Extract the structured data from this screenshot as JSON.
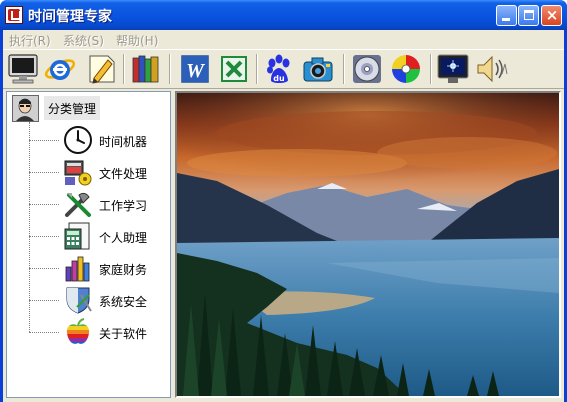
{
  "window": {
    "title": "时间管理专家",
    "accent": "#0a55e0"
  },
  "titlebar_buttons": {
    "minimize": "minimize-icon",
    "maximize": "maximize-icon",
    "close_glyph": "×"
  },
  "menu": {
    "items": [
      {
        "label": "执行(R)"
      },
      {
        "label": "系统(S)"
      },
      {
        "label": "帮助(H)"
      }
    ]
  },
  "toolbar": {
    "buttons": [
      {
        "icon": "monitor-icon"
      },
      {
        "icon": "internet-explorer-icon"
      },
      {
        "icon": "edit-document-icon"
      },
      {
        "icon": "books-icon"
      },
      {
        "icon": "word-icon"
      },
      {
        "icon": "excel-icon"
      },
      {
        "icon": "baidu-paw-icon"
      },
      {
        "icon": "camera-icon"
      },
      {
        "icon": "media-disc-icon"
      },
      {
        "icon": "color-cd-icon"
      },
      {
        "icon": "screen-icon"
      },
      {
        "icon": "speaker-icon"
      }
    ]
  },
  "tree": {
    "root": {
      "label": "分类管理",
      "icon": "user-avatar-icon"
    },
    "nodes": [
      {
        "label": "时间机器",
        "icon": "clock-icon"
      },
      {
        "label": "文件处理",
        "icon": "file-process-icon"
      },
      {
        "label": "工作学习",
        "icon": "tools-icon"
      },
      {
        "label": "个人助理",
        "icon": "calculator-icon"
      },
      {
        "label": "家庭财务",
        "icon": "bar-chart-icon"
      },
      {
        "label": "系统安全",
        "icon": "shield-icon"
      },
      {
        "label": "关于软件",
        "icon": "apple-icon"
      }
    ]
  },
  "main_image": {
    "subject": "mountain-lake-sunset",
    "colors": {
      "sky": "#b8562a",
      "lake": "#3d7dab",
      "forest": "#14301e"
    }
  }
}
